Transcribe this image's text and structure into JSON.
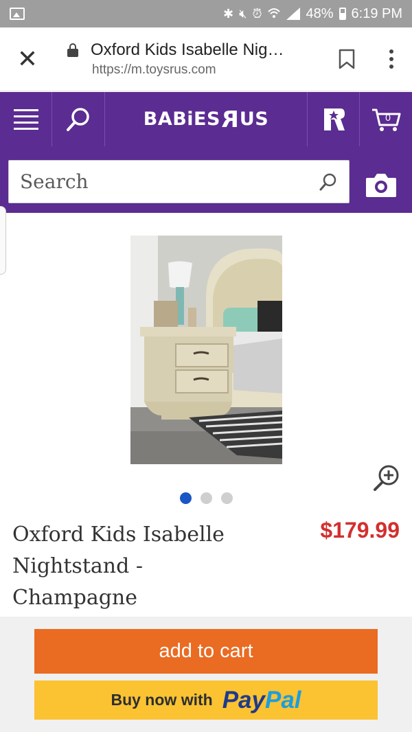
{
  "status_bar": {
    "battery": "48%",
    "time": "6:19 PM",
    "icons": [
      "gallery-icon",
      "bluetooth-icon",
      "mute-icon",
      "alarm-icon",
      "wifi-icon",
      "signal-icon",
      "battery-icon"
    ]
  },
  "browser": {
    "page_title": "Oxford Kids Isabelle Nig…",
    "url": "https://m.toysrus.com",
    "icons": [
      "close-icon",
      "lock-icon",
      "bookmark-icon",
      "more-vert-icon"
    ]
  },
  "header": {
    "logo_left": "BABiES",
    "logo_r": "R",
    "logo_right": "US",
    "cart_count": "0",
    "icons": [
      "menu-icon",
      "search-icon",
      "toysrus-star-icon",
      "cart-icon"
    ]
  },
  "search": {
    "placeholder": "Search",
    "icons": [
      "search-icon",
      "camera-icon"
    ]
  },
  "product": {
    "title_line1": "Oxford Kids Isabelle",
    "title_line2": "Nightstand -",
    "title_line3": "Champagne",
    "price": "$179.99",
    "carousel_total": 3,
    "carousel_active": 1
  },
  "actions": {
    "add_to_cart": "add to cart",
    "paypal_prefix": "Buy now with",
    "paypal_pay": "Pay",
    "paypal_pal": "Pal"
  },
  "colors": {
    "brand_purple": "#5b2c91",
    "price_red": "#d32f2f",
    "cart_orange": "#ea6b22",
    "paypal_yellow": "#fbc232",
    "carousel_active": "#1a56c4"
  }
}
